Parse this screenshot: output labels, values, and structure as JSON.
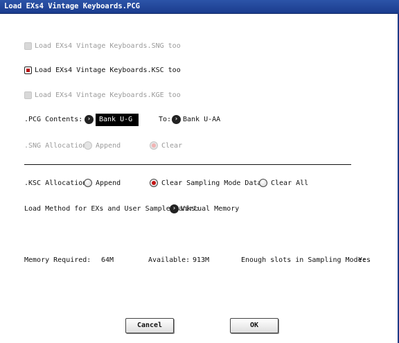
{
  "window": {
    "title": "Load EXs4 Vintage Keyboards.PCG"
  },
  "options": {
    "load_sng": {
      "label": "Load EXs4 Vintage Keyboards.SNG too",
      "checked": false,
      "enabled": false
    },
    "load_ksc": {
      "label": "Load EXs4 Vintage Keyboards.KSC too",
      "checked": true,
      "enabled": true
    },
    "load_kge": {
      "label": "Load EXs4 Vintage Keyboards.KGE too",
      "checked": false,
      "enabled": false
    }
  },
  "pcg_contents": {
    "label": ".PCG Contents:",
    "from_value": "Bank U-G",
    "to_label": "To:",
    "to_value": "Bank U-AA"
  },
  "sng_allocation": {
    "label": ".SNG Allocation:",
    "options": [
      "Append",
      "Clear"
    ],
    "selected": "Clear",
    "enabled": false
  },
  "ksc_allocation": {
    "label": ".KSC Allocation:",
    "options": [
      "Append",
      "Clear Sampling Mode Data",
      "Clear All"
    ],
    "selected": "Clear Sampling Mode Data"
  },
  "load_method": {
    "label": "Load Method for EXs and User Sample Banks:",
    "value": "Virtual Memory"
  },
  "memory": {
    "required_label": "Memory Required:",
    "required_value": "64M",
    "available_label": "Available:",
    "available_value": "913M",
    "slots_label": "Enough slots in Sampling Mode:",
    "slots_value": "Yes"
  },
  "buttons": {
    "cancel": "Cancel",
    "ok": "OK"
  },
  "colors": {
    "title_bar": "#1f418f",
    "accent_red": "#c41616"
  }
}
